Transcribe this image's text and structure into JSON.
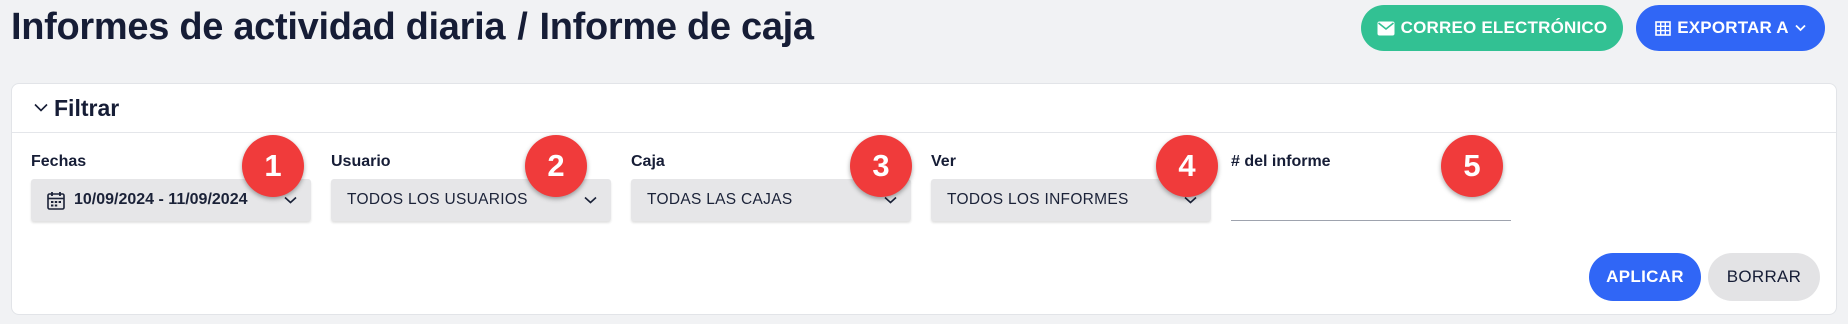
{
  "header": {
    "breadcrumb_parent": "Informes de actividad diaria",
    "separator": "/",
    "title": "Informe de caja",
    "email_label": "CORREO ELECTRÓNICO",
    "email_icon": "envelope-icon",
    "export_label": "EXPORTAR A",
    "export_icon": "table-icon",
    "colors": {
      "email": "#32c193",
      "export": "#3066f6"
    }
  },
  "filter": {
    "title": "Filtrar",
    "fields": [
      {
        "label": "Fechas",
        "value": "10/09/2024 - 11/09/2024",
        "icon": "calendar-icon",
        "badge": "1"
      },
      {
        "label": "Usuario",
        "value": "TODOS LOS USUARIOS",
        "badge": "2"
      },
      {
        "label": "Caja",
        "value": "TODAS LAS CAJAS",
        "badge": "3"
      },
      {
        "label": "Ver",
        "value": "TODOS LOS INFORMES",
        "badge": "4"
      },
      {
        "label": "# del informe",
        "value": "",
        "badge": "5"
      }
    ],
    "apply_label": "APLICAR",
    "clear_label": "BORRAR",
    "colors": {
      "badge": "#f03b3b",
      "apply": "#3066f6",
      "clear": "#e3e3e5"
    }
  }
}
